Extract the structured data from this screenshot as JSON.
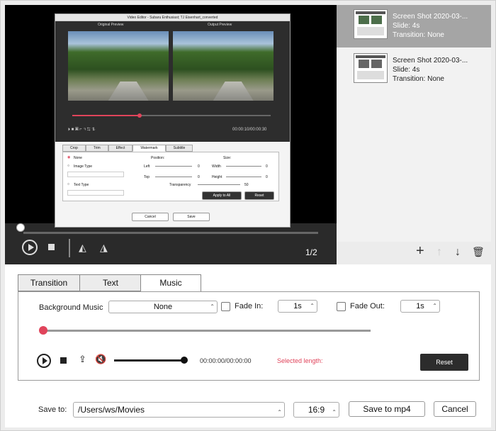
{
  "preview": {
    "inner_title": "Video Editor - Subaru Enthusiast; TJ Eisenhart_converted",
    "original_label": "Original Preview",
    "output_label": "Output Preview",
    "inner_time": "00:00:10/00:00:30",
    "inner_tabs": [
      "Crop",
      "Trim",
      "Effect",
      "Watermark",
      "Subtitle"
    ],
    "inner_active_tab": "Watermark",
    "wm_none": "None",
    "wm_image": "Image Type",
    "wm_text": "Text Type",
    "wm_position": "Position:",
    "wm_size": "Size:",
    "wm_left": "Left",
    "wm_top": "Top",
    "wm_width": "Width",
    "wm_height": "Height",
    "wm_transparency": "Transparency",
    "wm_zero": "0",
    "wm_fifty": "50",
    "apply_all": "Apply to All",
    "inner_reset": "Reset",
    "inner_cancel": "Cancel",
    "inner_save": "Save",
    "page_indicator": "1/2"
  },
  "slides": [
    {
      "name": "Screen Shot 2020-03-...",
      "slide": "Slide: 4s",
      "transition": "Transition: None",
      "selected": true
    },
    {
      "name": "Screen Shot 2020-03-...",
      "slide": "Slide: 4s",
      "transition": "Transition: None",
      "selected": false
    }
  ],
  "slide_toolbar": {
    "add": "+",
    "up": "↑",
    "down": "↓",
    "delete": "🗑"
  },
  "tabs": [
    {
      "label": "Transition",
      "active": false
    },
    {
      "label": "Text",
      "active": false
    },
    {
      "label": "Music",
      "active": true
    }
  ],
  "music": {
    "bg_label": "Background Music",
    "bg_value": "None",
    "fade_in_label": "Fade In:",
    "fade_in_value": "1s",
    "fade_out_label": "Fade Out:",
    "fade_out_value": "1s",
    "time": "00:00:00/00:00:00",
    "selected_length": "Selected length:",
    "reset": "Reset",
    "progress": 0.0,
    "volume": 1.0
  },
  "save": {
    "label": "Save to:",
    "path": "/Users/ws/Movies",
    "ratio": "16:9",
    "save_button": "Save to mp4",
    "cancel_button": "Cancel"
  },
  "colors": {
    "accent": "#e0445b",
    "selected_slide": "#a5a5a5"
  }
}
